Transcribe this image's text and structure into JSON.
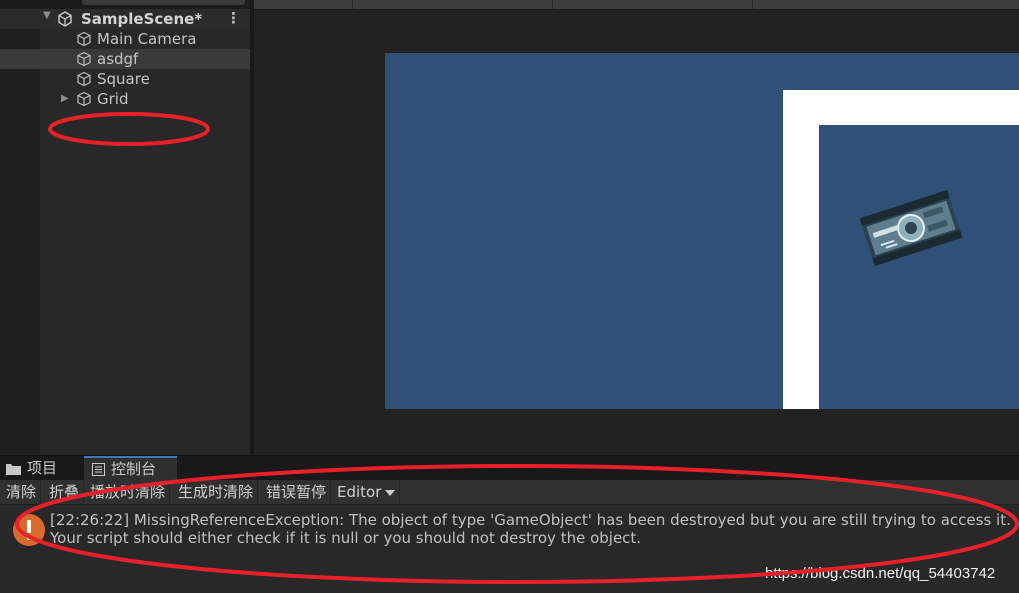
{
  "hierarchy": {
    "scene_name": "SampleScene*",
    "items": [
      {
        "label": "Main Camera"
      },
      {
        "label": "asdgf"
      },
      {
        "label": "Square"
      },
      {
        "label": "Grid"
      }
    ]
  },
  "bottom_tabs": [
    {
      "label": "项目",
      "icon": "folder-icon"
    },
    {
      "label": "控制台",
      "icon": "console-icon"
    }
  ],
  "console": {
    "toolbar": {
      "clear": "清除",
      "collapse": "折叠",
      "clear_on_play": "播放时清除",
      "clear_on_build": "生成时清除",
      "error_pause": "错误暂停",
      "editor": "Editor"
    },
    "messages": [
      {
        "type": "error",
        "icon": "warning-icon",
        "line1": "[22:26:22] MissingReferenceException: The object of type 'GameObject' has been destroyed but you are still trying to access it.",
        "line2": "Your script should either check if it is null or you should not destroy the object."
      }
    ]
  },
  "watermark": "https://blog.csdn.net/qq_54403742",
  "colors": {
    "game_background": "#305078",
    "annotation": "#e8202a",
    "error_icon": "#e0702a",
    "active_tab_accent": "#3a79bb"
  }
}
